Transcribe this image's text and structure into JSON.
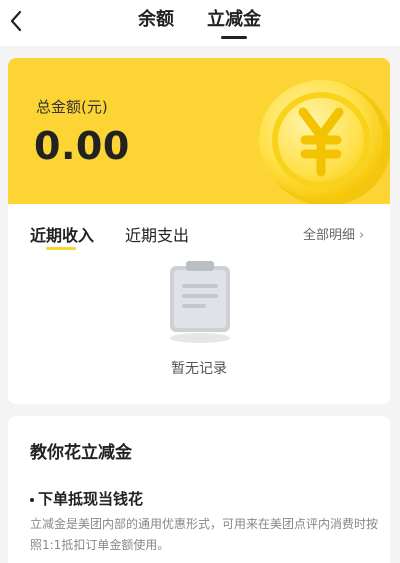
{
  "header": {
    "tabs": [
      {
        "label": "余额",
        "active": false
      },
      {
        "label": "立减金",
        "active": true
      }
    ]
  },
  "summary": {
    "total_label": "总金额(元)",
    "total_value": "0.00",
    "coin_icon": "yuan-coin-icon",
    "accent_color": "#fcd433"
  },
  "records": {
    "tabs": [
      {
        "label": "近期收入",
        "active": true
      },
      {
        "label": "近期支出",
        "active": false
      }
    ],
    "all_detail_label": "全部明细",
    "empty_text": "暂无记录"
  },
  "tips": {
    "title": "教你花立减金",
    "subtitle": "下单抵现当钱花",
    "description": "立减金是美团内部的通用优惠形式，可用来在美团点评内消费时按照1:1抵扣订单金额使用。"
  }
}
